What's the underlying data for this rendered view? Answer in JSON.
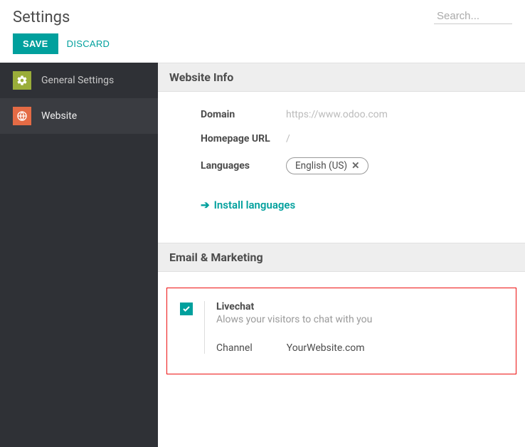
{
  "header": {
    "title": "Settings",
    "search_placeholder": "Search..."
  },
  "actions": {
    "save_label": "SAVE",
    "discard_label": "DISCARD"
  },
  "sidebar": {
    "items": [
      {
        "label": "General Settings"
      },
      {
        "label": "Website"
      }
    ]
  },
  "sections": {
    "website_info": {
      "heading": "Website Info",
      "domain_label": "Domain",
      "domain_value": "https://www.odoo.com",
      "homepage_label": "Homepage URL",
      "homepage_value": "/",
      "languages_label": "Languages",
      "language_tag": "English (US)",
      "install_link": "Install languages"
    },
    "email_marketing": {
      "heading": "Email & Marketing",
      "livechat_title": "Livechat",
      "livechat_desc": "Alows your visitors to chat with you",
      "channel_label": "Channel",
      "channel_value": "YourWebsite.com"
    }
  }
}
